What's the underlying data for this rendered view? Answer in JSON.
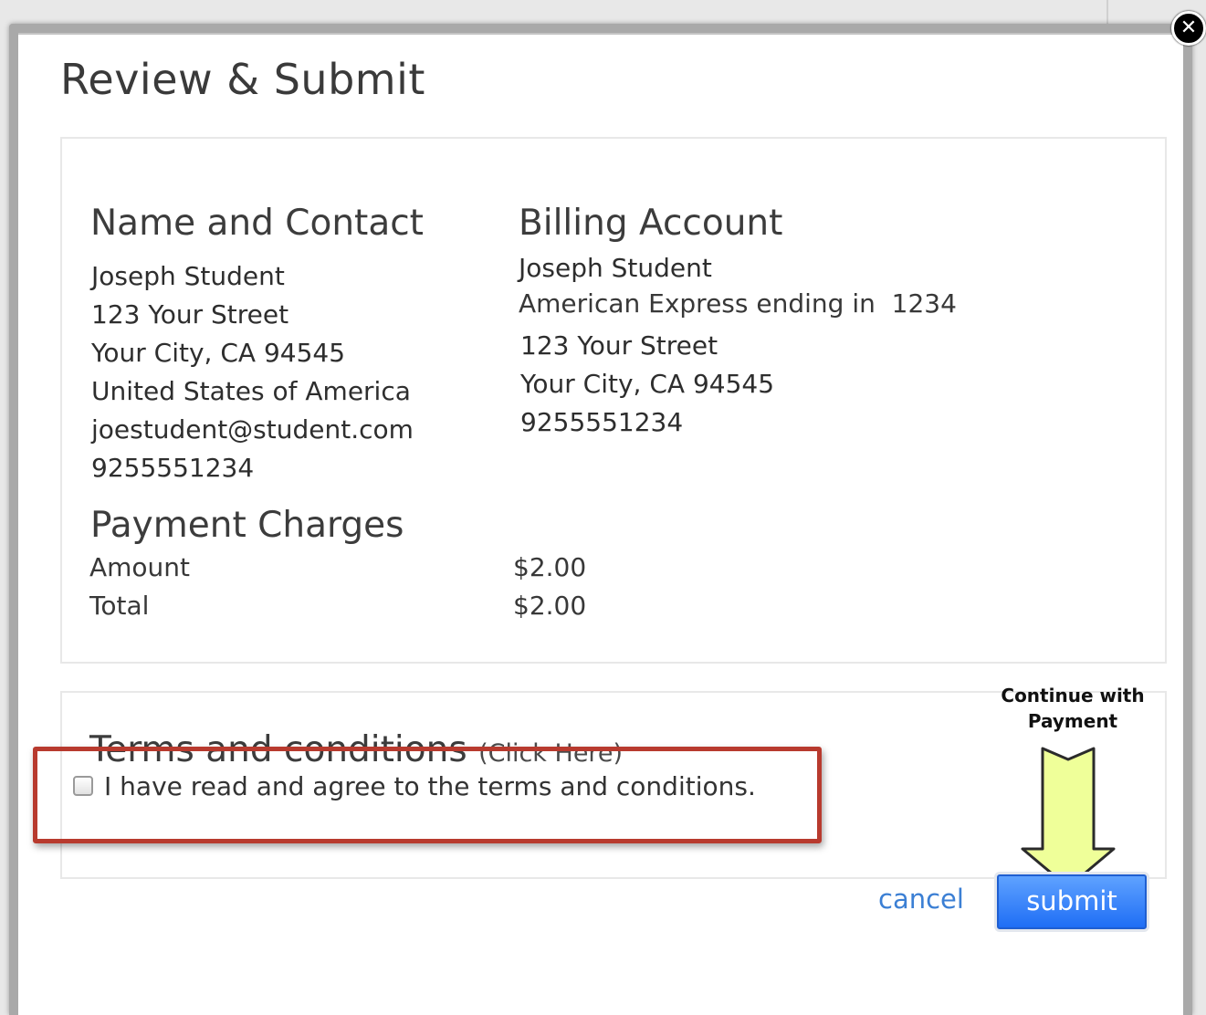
{
  "modal": {
    "title": "Review & Submit",
    "close_glyph": "✕"
  },
  "contact": {
    "heading": "Name and Contact",
    "lines": [
      "Joseph Student",
      "123 Your Street",
      "Your City, CA 94545",
      "United States of America",
      "joestudent@student.com",
      "9255551234"
    ]
  },
  "billing": {
    "heading": "Billing Account",
    "name": "Joseph Student",
    "card_label": "American Express ending in",
    "card_last4": "1234",
    "lines": [
      "123 Your Street",
      "Your City, CA 94545",
      "9255551234"
    ]
  },
  "charges": {
    "heading": "Payment Charges",
    "rows": [
      {
        "label": "Amount",
        "value": "$2.00"
      },
      {
        "label": "Total",
        "value": "$2.00"
      }
    ]
  },
  "terms": {
    "heading": "Terms and conditions",
    "link_label": "(Click Here)",
    "agree_label": "I have read and agree to the terms and conditions.",
    "agree_checked": false
  },
  "callout": {
    "line1": "Continue with",
    "line2": "Payment",
    "arrow_color": "#efff99"
  },
  "actions": {
    "cancel_label": "cancel",
    "submit_label": "submit"
  },
  "colors": {
    "link": "#3b7fd4",
    "submit": "#1f6ef5",
    "highlight_box": "#b83a2e"
  }
}
